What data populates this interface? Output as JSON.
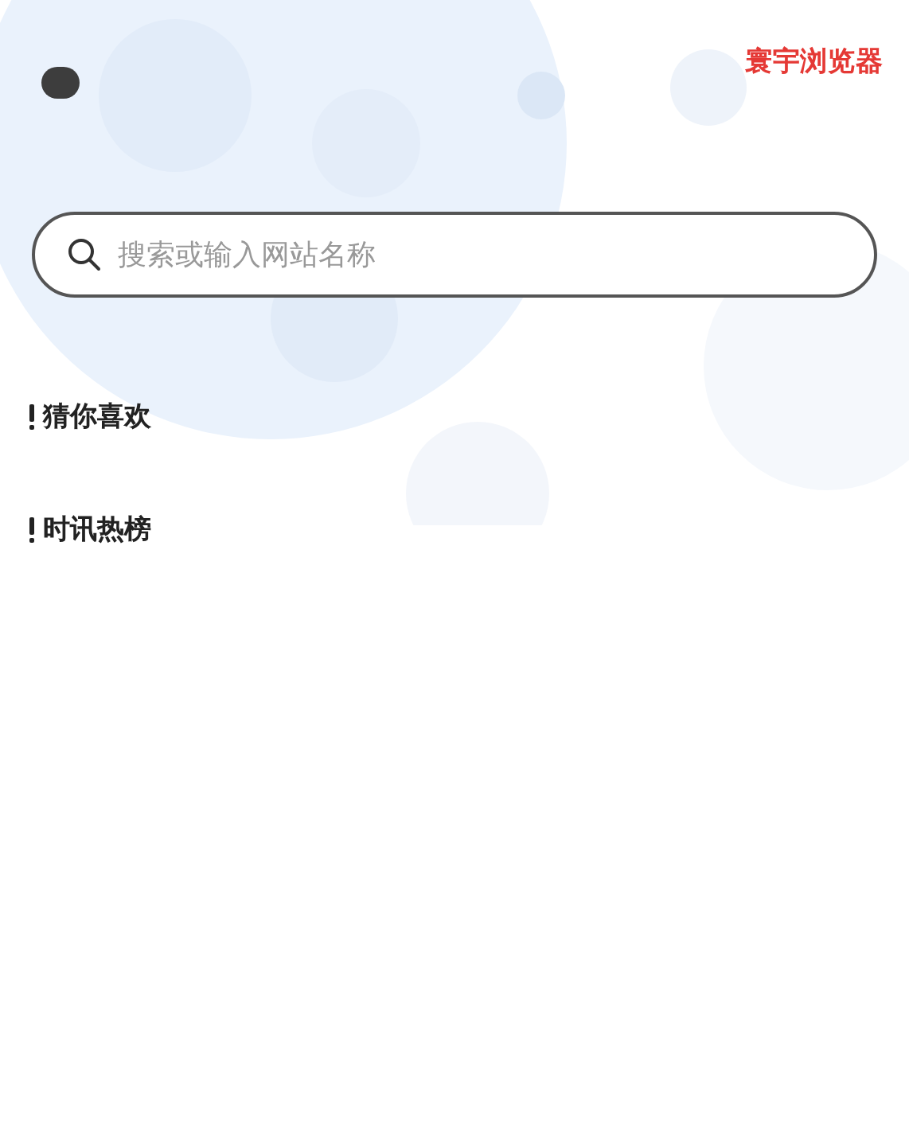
{
  "header": {
    "brand": "寰宇浏览器"
  },
  "search": {
    "placeholder": "搜索或输入网站名称"
  },
  "sections": [
    {
      "title": "猜你喜欢"
    },
    {
      "title": "时讯热榜"
    }
  ]
}
